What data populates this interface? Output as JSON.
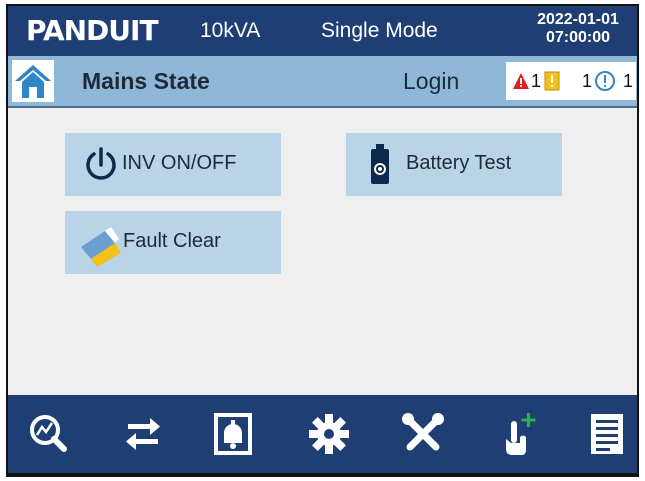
{
  "header": {
    "brand": "PANDUIT",
    "rating": "10kVA",
    "mode": "Single Mode",
    "date": "2022-01-01",
    "time": "07:00:00"
  },
  "status": {
    "state": "Mains State",
    "login_label": "Login",
    "alarms": {
      "critical_count": "1",
      "minor_count": "1",
      "info_count": "1"
    }
  },
  "actions": {
    "inv_onoff": "INV ON/OFF",
    "battery_test": "Battery Test",
    "fault_clear": "Fault Clear"
  },
  "colors": {
    "navy": "#1f3f74",
    "status_blue": "#8fb7d7",
    "button_blue": "#b8d4e6"
  },
  "dock": [
    {
      "icon": "search-icon"
    },
    {
      "icon": "transfer-arrows-icon"
    },
    {
      "icon": "alarm-bell-icon"
    },
    {
      "icon": "gear-icon"
    },
    {
      "icon": "tools-icon"
    },
    {
      "icon": "touch-hand-icon"
    },
    {
      "icon": "log-list-icon"
    }
  ]
}
